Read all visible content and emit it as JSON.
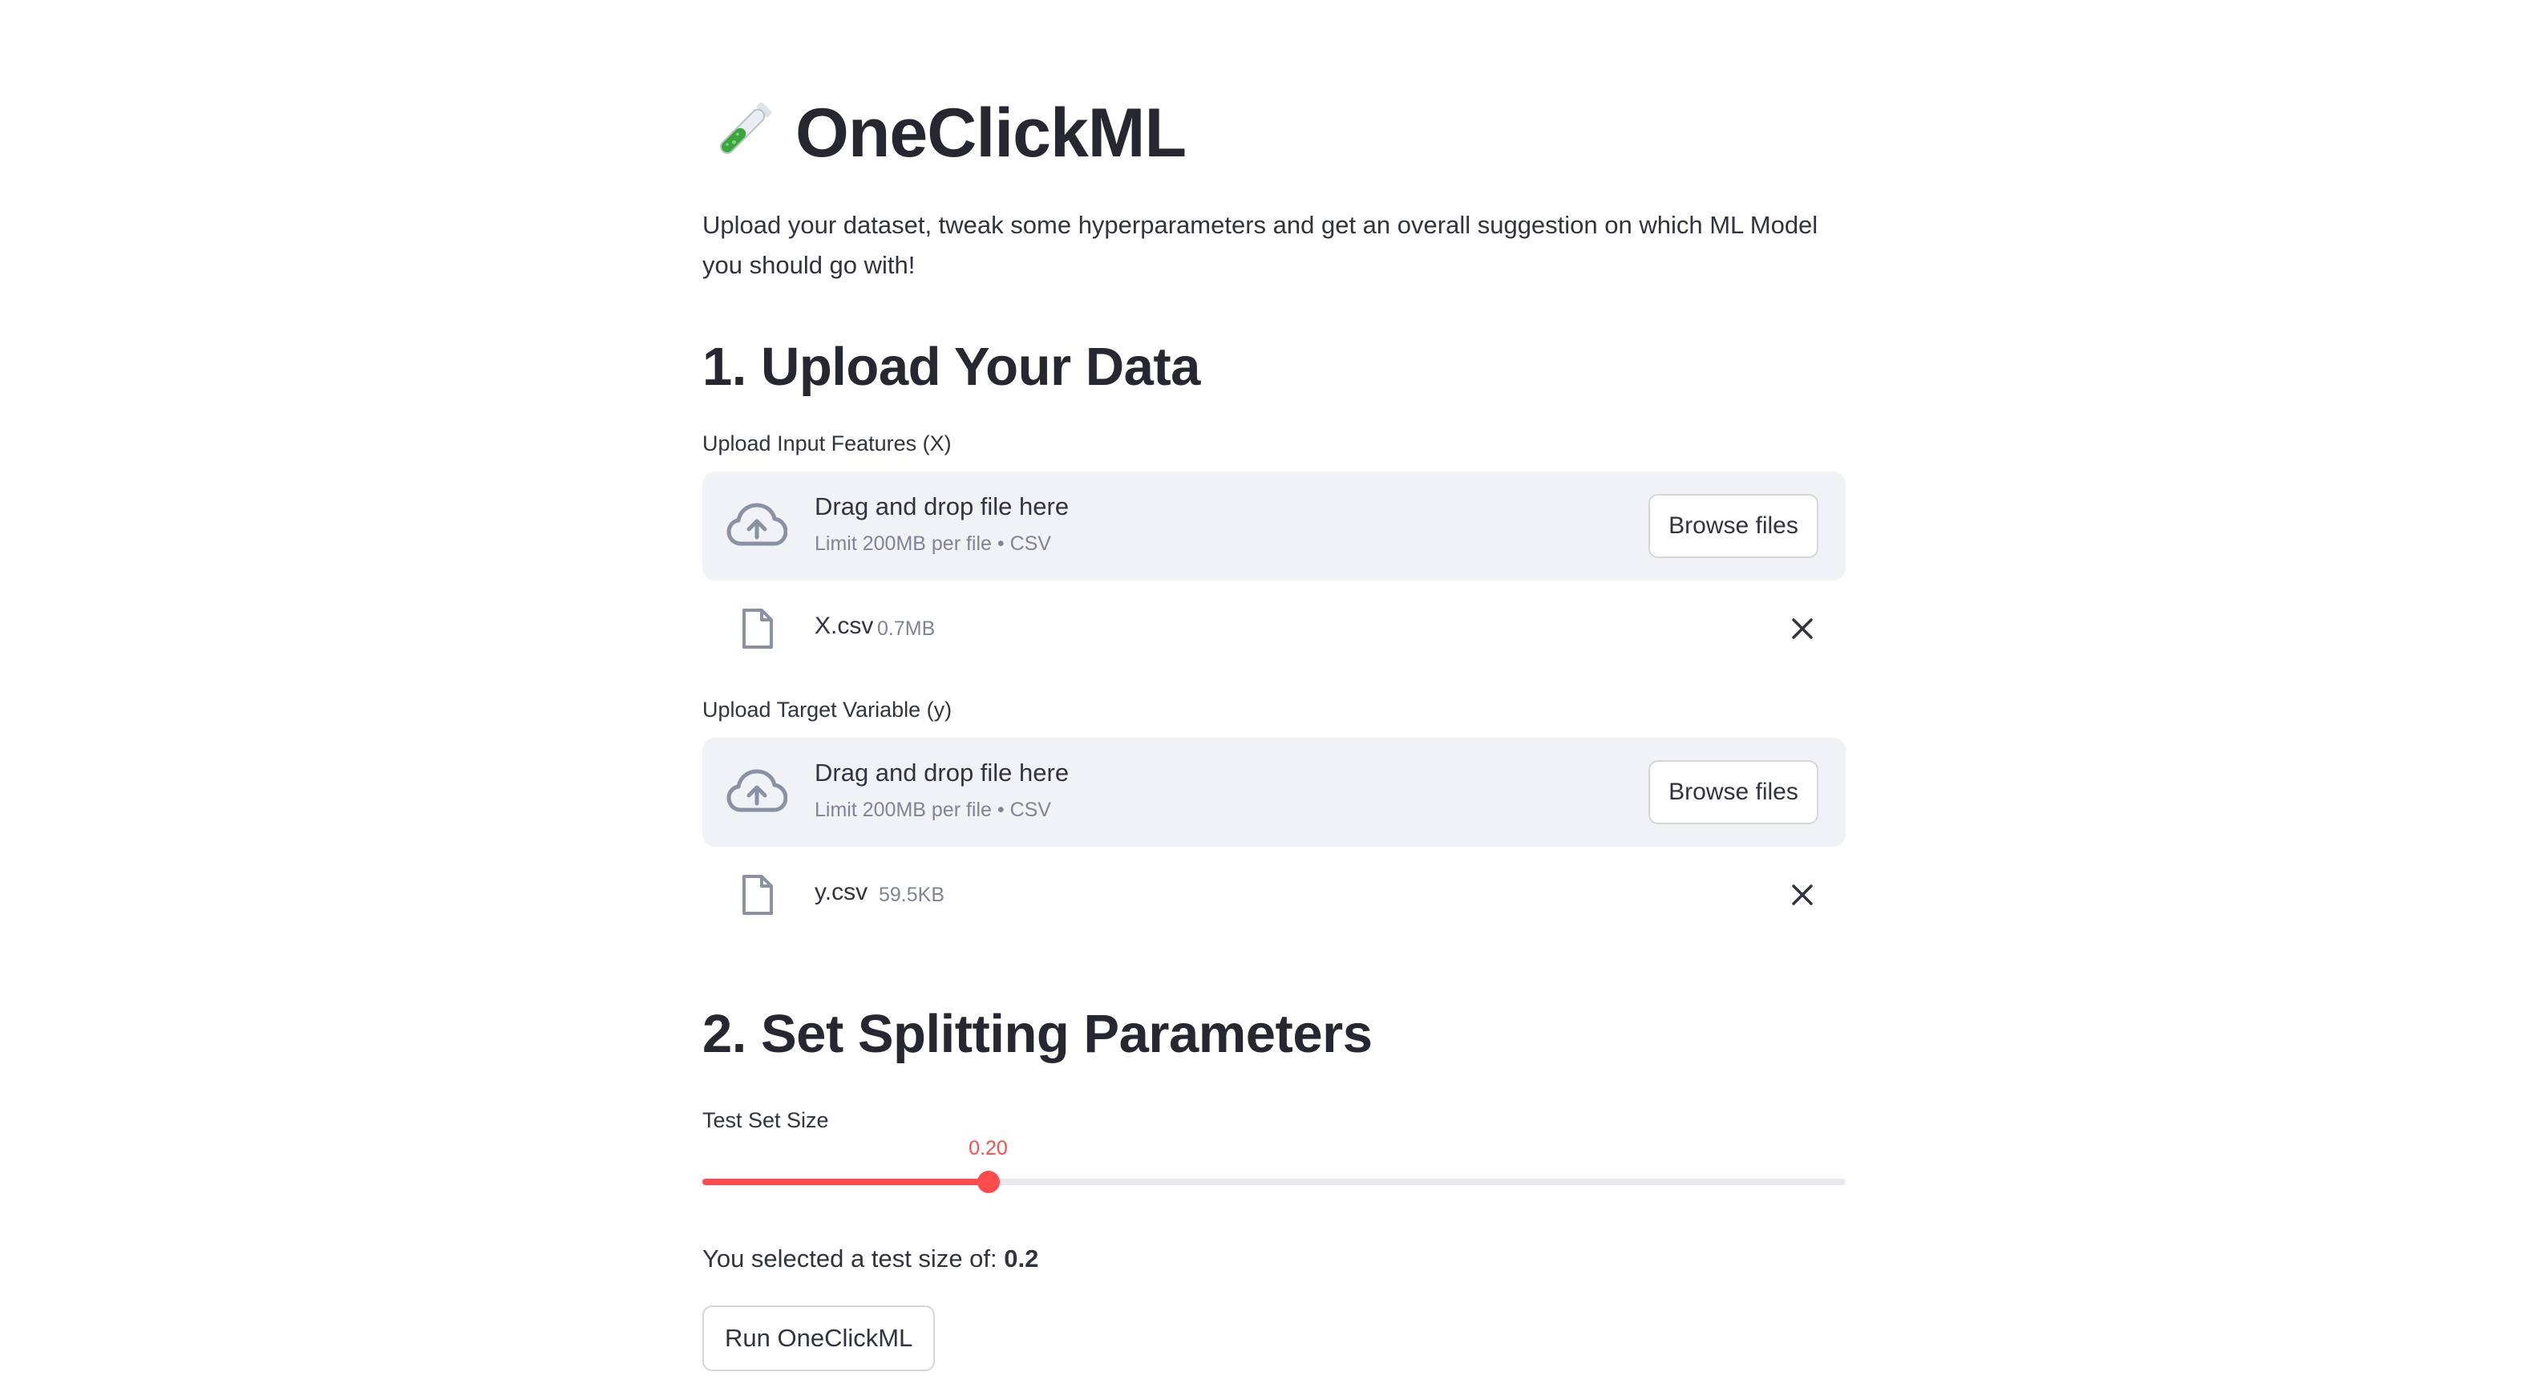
{
  "app": {
    "title": "OneClickML",
    "title_icon": "test-tube-icon",
    "intro": "Upload your dataset, tweak some hyperparameters and get an overall suggestion on which ML Model you should go with!"
  },
  "section1": {
    "heading": "1. Upload Your Data",
    "uploaders": [
      {
        "label": "Upload Input Features (X)",
        "drop_text": "Drag and drop file here",
        "limit_text": "Limit 200MB per file • CSV",
        "browse_label": "Browse files",
        "file": {
          "name": "X.csv",
          "size": "0.7MB"
        }
      },
      {
        "label": "Upload Target Variable (y)",
        "drop_text": "Drag and drop file here",
        "limit_text": "Limit 200MB per file • CSV",
        "browse_label": "Browse files",
        "file": {
          "name": "y.csv",
          "size": "59.5KB"
        }
      }
    ]
  },
  "section2": {
    "heading": "2. Set Splitting Parameters",
    "slider": {
      "label": "Test Set Size",
      "value_label": "0.20",
      "value": 0.2,
      "min": 0.0,
      "max": 0.8
    },
    "selected_prefix": "You selected a test size of: ",
    "selected_value": "0.2",
    "run_label": "Run OneClickML"
  },
  "colors": {
    "accent": "#ff4b4b",
    "dropzone_bg": "#f0f2f6",
    "text": "#31333f",
    "muted": "#808495"
  }
}
